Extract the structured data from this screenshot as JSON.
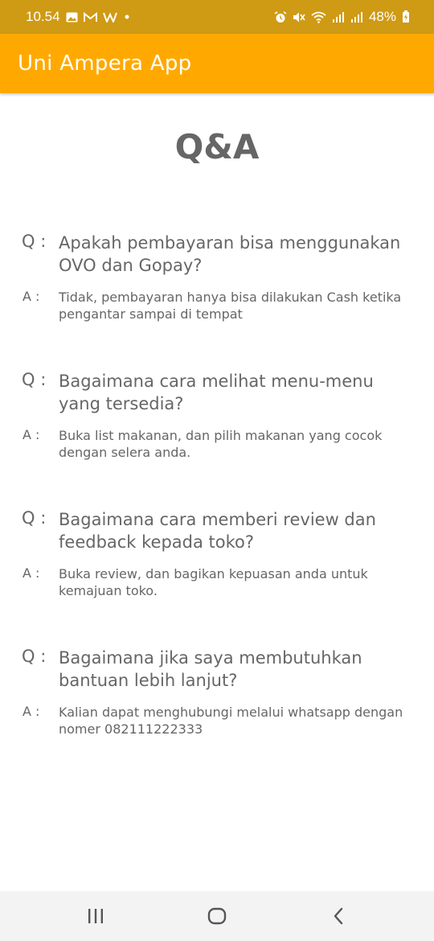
{
  "status_bar": {
    "time": "10.54",
    "battery": "48%",
    "left_icons": [
      "image-icon",
      "gmail-icon",
      "w-icon",
      "dot-icon"
    ],
    "right_icons": [
      "alarm-icon",
      "mute-icon",
      "wifi-icon",
      "signal-icon",
      "signal-icon",
      "battery-icon"
    ]
  },
  "app_bar": {
    "title": "Uni Ampera App",
    "color": "#ffa900"
  },
  "page": {
    "title": "Q&A"
  },
  "qa": {
    "q_prefix": "Q :",
    "a_prefix": "A :",
    "items": [
      {
        "question": "Apakah pembayaran bisa menggunakan OVO dan Gopay?",
        "answer": "Tidak, pembayaran hanya bisa dilakukan Cash ketika pengantar sampai di tempat"
      },
      {
        "question": "Bagaimana cara melihat menu-menu yang tersedia?",
        "answer": "Buka list makanan, dan pilih makanan yang cocok dengan selera anda."
      },
      {
        "question": "Bagaimana cara memberi review dan feedback kepada toko?",
        "answer": "Buka review, dan bagikan kepuasan anda untuk kemajuan toko."
      },
      {
        "question": "Bagaimana jika saya membutuhkan bantuan lebih lanjut?",
        "answer": "Kalian dapat menghubungi melalui whatsapp dengan nomer 082111222333"
      }
    ]
  },
  "nav_bar": {
    "icons": [
      "recents-icon",
      "home-icon",
      "back-icon"
    ]
  }
}
